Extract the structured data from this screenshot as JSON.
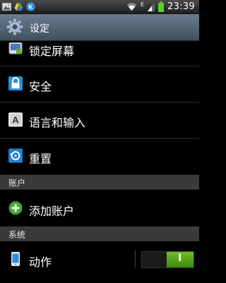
{
  "status_bar": {
    "time": "23:39",
    "network_type": "E",
    "left_icons": [
      "image-icon",
      "drive-icon",
      "k-app-icon"
    ],
    "right_icons": [
      "wifi-icon",
      "signal-icon",
      "battery-icon"
    ],
    "colors": {
      "battery": "#5bd12a",
      "k_app": "#2d8fd6"
    }
  },
  "header": {
    "title": "设定",
    "icon": "settings-gear-icon"
  },
  "items": [
    {
      "label": "锁定屏幕",
      "icon": "lock-screen-icon"
    },
    {
      "label": "安全",
      "icon": "security-lock-icon"
    },
    {
      "label": "语言和输入",
      "icon": "language-keyboard-icon"
    },
    {
      "label": "重置",
      "icon": "reset-icon"
    }
  ],
  "sections": {
    "accounts": "账户",
    "system": "系统"
  },
  "accounts": {
    "add_account_label": "添加账户",
    "icon": "add-icon"
  },
  "system": {
    "motion_label": "动作",
    "motion_icon": "phone-motion-icon",
    "motion_toggle": {
      "state": "on",
      "text": "I"
    }
  }
}
